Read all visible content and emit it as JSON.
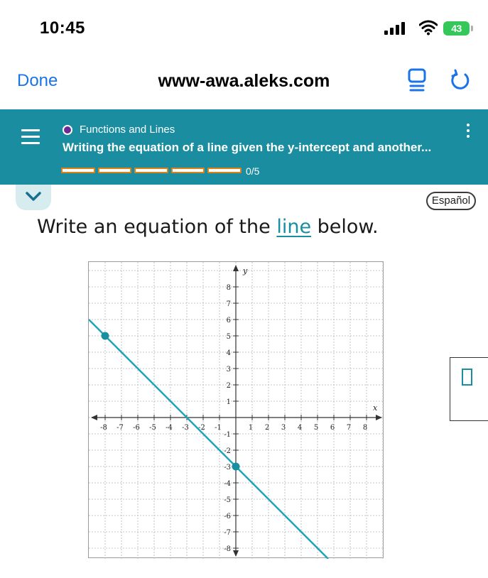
{
  "status": {
    "time": "10:45",
    "battery": "43"
  },
  "browser": {
    "done_label": "Done",
    "url": "www-awa.aleks.com"
  },
  "header": {
    "topic": "Functions and Lines",
    "lesson_title": "Writing the equation of a line given the y-intercept and another...",
    "progress_text": "0/5",
    "progress_completed": 0,
    "progress_total": 5,
    "topic_color": "#6b2b97",
    "bg_color": "#1b8da0",
    "progress_color": "#d9821e"
  },
  "controls": {
    "espanol_label": "Español"
  },
  "question": {
    "prefix": "Write an equation of the ",
    "link": "line",
    "suffix": " below."
  },
  "graph": {
    "x_axis_label": "x",
    "y_axis_label": "y",
    "x_range": [
      -8,
      8
    ],
    "y_range": [
      -8,
      8
    ],
    "x_tick_labels": [
      "-8",
      "-7",
      "-6",
      "-5",
      "-4",
      "-3",
      "-2",
      "-1",
      "1",
      "2",
      "3",
      "4",
      "5",
      "6",
      "7",
      "8"
    ],
    "y_tick_labels": [
      "8",
      "7",
      "6",
      "5",
      "4",
      "3",
      "2",
      "1",
      "-1",
      "-2",
      "-3",
      "-4",
      "-5",
      "-6",
      "-7",
      "-8"
    ],
    "points": [
      {
        "x": -8,
        "y": 5
      },
      {
        "x": 0,
        "y": -3
      }
    ],
    "line_color": "#1fa3b8",
    "point_color": "#1b8da0"
  },
  "answer": {
    "value": ""
  }
}
